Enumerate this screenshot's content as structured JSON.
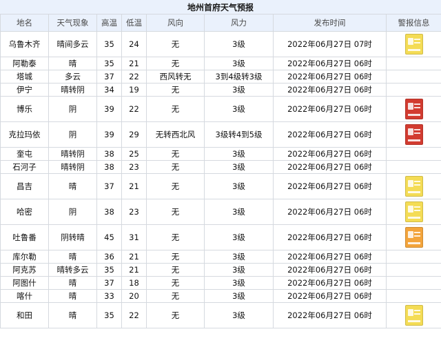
{
  "title": "地州首府天气预报",
  "headers": [
    "地名",
    "天气现象",
    "高温",
    "低温",
    "风向",
    "风力",
    "发布时间",
    "警报信息"
  ],
  "rows": [
    {
      "city": "乌鲁木齐",
      "weather": "晴间多云",
      "high": "35",
      "low": "24",
      "wind_dir": "无",
      "wind_force": "3级",
      "time": "2022年06月27日 07时",
      "alert": "yellow"
    },
    {
      "city": "阿勒泰",
      "weather": "晴",
      "high": "35",
      "low": "21",
      "wind_dir": "无",
      "wind_force": "3级",
      "time": "2022年06月27日 06时",
      "alert": ""
    },
    {
      "city": "塔城",
      "weather": "多云",
      "high": "37",
      "low": "22",
      "wind_dir": "西风转无",
      "wind_force": "3到4级转3级",
      "time": "2022年06月27日 06时",
      "alert": ""
    },
    {
      "city": "伊宁",
      "weather": "晴转阴",
      "high": "34",
      "low": "19",
      "wind_dir": "无",
      "wind_force": "3级",
      "time": "2022年06月27日 06时",
      "alert": ""
    },
    {
      "city": "博乐",
      "weather": "阴",
      "high": "39",
      "low": "22",
      "wind_dir": "无",
      "wind_force": "3级",
      "time": "2022年06月27日 06时",
      "alert": "red"
    },
    {
      "city": "克拉玛依",
      "weather": "阴",
      "high": "39",
      "low": "29",
      "wind_dir": "无转西北风",
      "wind_force": "3级转4到5级",
      "time": "2022年06月27日 06时",
      "alert": "red"
    },
    {
      "city": "奎屯",
      "weather": "晴转阴",
      "high": "38",
      "low": "25",
      "wind_dir": "无",
      "wind_force": "3级",
      "time": "2022年06月27日 06时",
      "alert": ""
    },
    {
      "city": "石河子",
      "weather": "晴转阴",
      "high": "38",
      "low": "23",
      "wind_dir": "无",
      "wind_force": "3级",
      "time": "2022年06月27日 06时",
      "alert": ""
    },
    {
      "city": "昌吉",
      "weather": "晴",
      "high": "37",
      "low": "21",
      "wind_dir": "无",
      "wind_force": "3级",
      "time": "2022年06月27日 06时",
      "alert": "yellow"
    },
    {
      "city": "哈密",
      "weather": "阴",
      "high": "38",
      "low": "23",
      "wind_dir": "无",
      "wind_force": "3级",
      "time": "2022年06月27日 06时",
      "alert": "yellow"
    },
    {
      "city": "吐鲁番",
      "weather": "阴转晴",
      "high": "45",
      "low": "31",
      "wind_dir": "无",
      "wind_force": "3级",
      "time": "2022年06月27日 06时",
      "alert": "orange"
    },
    {
      "city": "库尔勒",
      "weather": "晴",
      "high": "36",
      "low": "21",
      "wind_dir": "无",
      "wind_force": "3级",
      "time": "2022年06月27日 06时",
      "alert": ""
    },
    {
      "city": "阿克苏",
      "weather": "晴转多云",
      "high": "35",
      "low": "21",
      "wind_dir": "无",
      "wind_force": "3级",
      "time": "2022年06月27日 06时",
      "alert": ""
    },
    {
      "city": "阿图什",
      "weather": "晴",
      "high": "37",
      "low": "18",
      "wind_dir": "无",
      "wind_force": "3级",
      "time": "2022年06月27日 06时",
      "alert": ""
    },
    {
      "city": "喀什",
      "weather": "晴",
      "high": "33",
      "low": "20",
      "wind_dir": "无",
      "wind_force": "3级",
      "time": "2022年06月27日 06时",
      "alert": ""
    },
    {
      "city": "和田",
      "weather": "晴",
      "high": "35",
      "low": "22",
      "wind_dir": "无",
      "wind_force": "3级",
      "time": "2022年06月27日 06时",
      "alert": "yellow"
    }
  ]
}
